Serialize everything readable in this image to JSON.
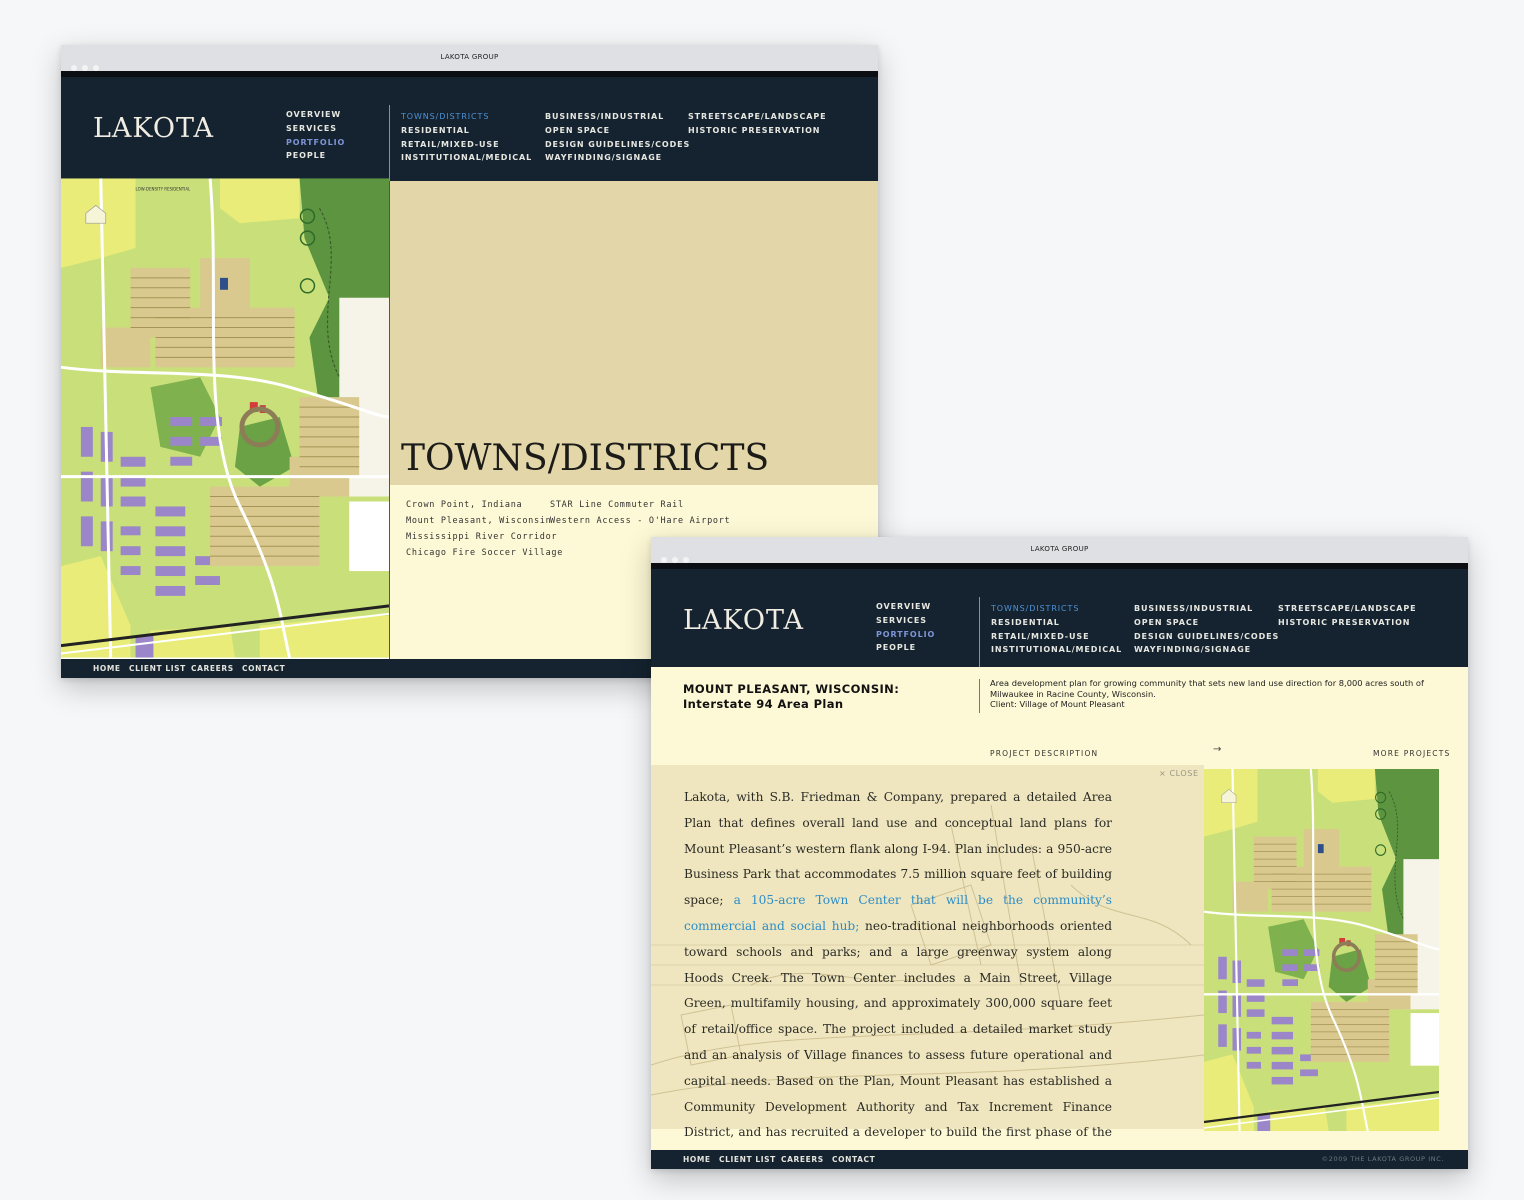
{
  "window_title": "LAKOTA GROUP",
  "logo": "LAKOTA",
  "main_nav": [
    "OVERVIEW",
    "SERVICES",
    "PORTFOLIO",
    "PEOPLE"
  ],
  "categories": {
    "col1": [
      "TOWNS/DISTRICTS",
      "RESIDENTIAL",
      "RETAIL/MIXED-USE",
      "INSTITUTIONAL/MEDICAL"
    ],
    "col2": [
      "BUSINESS/INDUSTRIAL",
      "OPEN SPACE",
      "DESIGN GUIDELINES/CODES",
      "WAYFINDING/SIGNAGE"
    ],
    "col3": [
      "STREETSCAPE/LANDSCAPE",
      "HISTORIC PRESERVATION"
    ]
  },
  "map_labels": {
    "low_density": "LOW-DENSITY RESIDENTIAL"
  },
  "section_title": "TOWNS/DISTRICTS",
  "projects": {
    "col1": [
      "Crown Point, Indiana",
      "Mount Pleasant, Wisconsin",
      "Mississippi River Corridor",
      "Chicago Fire Soccer Village"
    ],
    "col2": [
      "STAR Line Commuter Rail",
      "Western Access - O'Hare Airport"
    ]
  },
  "footer_nav": [
    "HOME",
    "CLIENT LIST",
    "CAREERS",
    "CONTACT"
  ],
  "project": {
    "title_line1": "MOUNT PLEASANT, WISCONSIN:",
    "title_line2": "Interstate 94 Area Plan",
    "summary_line1": "Area development plan for growing community that sets new land use direction for 8,000 acres south of Milwaukee in Racine County, Wisconsin.",
    "summary_line2": "Client: Village of Mount Pleasant",
    "description_label": "PROJECT DESCRIPTION",
    "arrow_icon": "→",
    "more_projects": "MORE PROJECTS",
    "close_label": "× CLOSE",
    "description_before": "Lakota, with S.B. Friedman & Company, prepared a detailed Area Plan that defines overall land use and conceptual land plans for Mount Pleasant’s western flank along I-94. Plan includes: a 950-acre Business Park that accommodates 7.5 million square feet of building space; ",
    "description_highlight": "a 105-acre Town Center that will be the community’s commercial and social hub;",
    "description_after": " neo-traditional neighborhoods oriented toward schools and parks; and a large greenway system along Hoods Creek. The Town Center includes a Main Street, Village Green, multifamily housing, and approximately 300,000 square feet of retail/office space. The project included a detailed market study and an analysis of Village finances to assess future operational and capital needs. Based on the Plan, Mount Pleasant has established a Community Development Authority and Tax Increment Finance District, and has recruited a developer to build the first phase of the Business Park."
  },
  "copyright": "©2009 THE LAKOTA GROUP INC.",
  "colors": {
    "header_navy": "#14232f",
    "tan_panel": "#e3d6a9",
    "cream_panel": "#fdf9d6",
    "active_nav_blue": "#4f92d6",
    "portfolio_nav": "#7d94d6",
    "link_highlight": "#2c8dc6"
  }
}
